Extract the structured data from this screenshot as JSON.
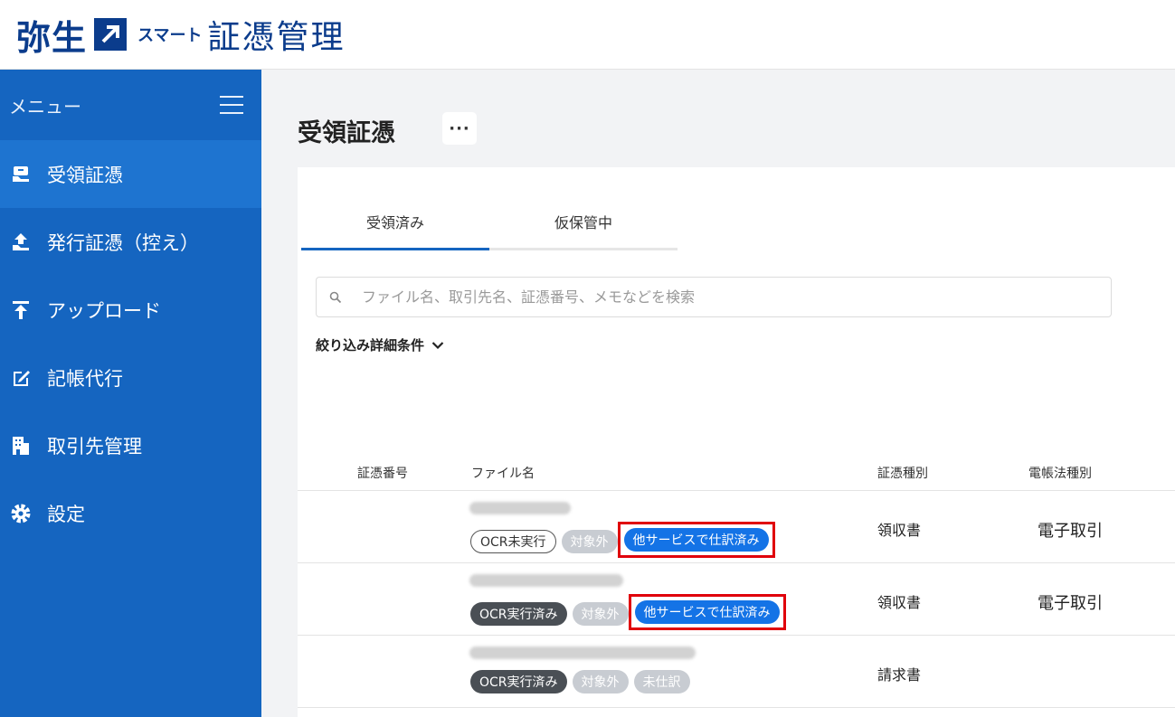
{
  "header": {
    "brand": "弥生",
    "smart": "スマート",
    "product": "証憑管理"
  },
  "sidebar": {
    "menu_label": "メニュー",
    "items": [
      {
        "label": "受領証憑",
        "icon": "receipt-hand-icon",
        "active": true
      },
      {
        "label": "発行証憑（控え）",
        "icon": "issue-upload-icon",
        "active": false
      },
      {
        "label": "アップロード",
        "icon": "upload-arrow-icon",
        "active": false
      },
      {
        "label": "記帳代行",
        "icon": "edit-check-icon",
        "active": false
      },
      {
        "label": "取引先管理",
        "icon": "building-icon",
        "active": false
      },
      {
        "label": "設定",
        "icon": "gear-icon",
        "active": false
      }
    ]
  },
  "main": {
    "title": "受領証憑",
    "more_label": "···",
    "tabs": [
      {
        "label": "受領済み",
        "active": true
      },
      {
        "label": "仮保管中",
        "active": false
      }
    ],
    "search": {
      "placeholder": "ファイル名、取引先名、証憑番号、メモなどを検索"
    },
    "filter_label": "絞り込み詳細条件",
    "table": {
      "headers": [
        "証憑番号",
        "ファイル名",
        "証憑種別",
        "電帳法種別"
      ],
      "rows": [
        {
          "tags": [
            "OCR未実行",
            "対象外",
            "他サービスで仕訳済み"
          ],
          "type": "領収書",
          "etype": "電子取引"
        },
        {
          "tags": [
            "OCR実行済み",
            "対象外",
            "他サービスで仕訳済み"
          ],
          "type": "領収書",
          "etype": "電子取引"
        },
        {
          "tags": [
            "OCR実行済み",
            "対象外",
            "未仕訳"
          ],
          "type": "請求書",
          "etype": ""
        }
      ]
    }
  },
  "colors": {
    "sidebar": "#1565c0",
    "sidebar_active": "#1e74d0",
    "brand": "#0b3c8c",
    "tag_blue": "#1473e6",
    "highlight": "#e0000b"
  }
}
